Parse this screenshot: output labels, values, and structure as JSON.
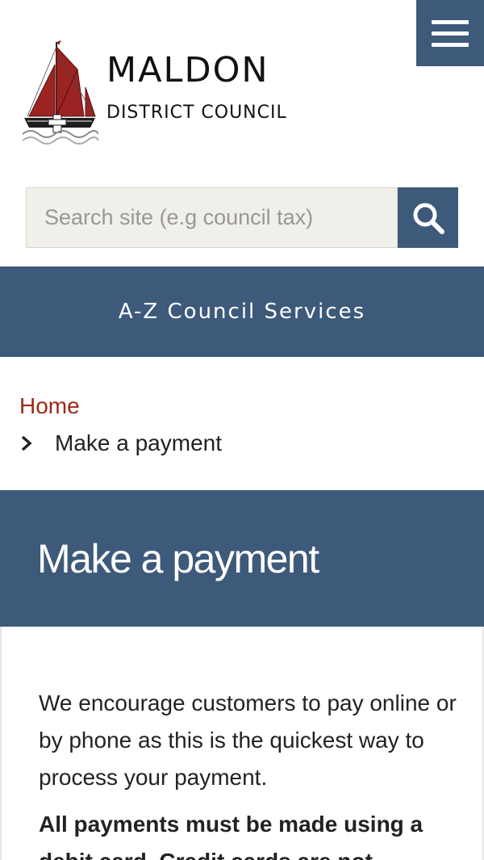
{
  "header": {
    "logo_title": "MALDON",
    "logo_subtitle": "DISTRICT COUNCIL",
    "menu_icon": "hamburger-menu-icon"
  },
  "search": {
    "placeholder": "Search site (e.g council tax)",
    "value": "",
    "icon": "search-icon"
  },
  "az_services": {
    "label": "A-Z Council Services"
  },
  "breadcrumb": {
    "home_label": "Home",
    "separator_icon": "chevron-right-icon",
    "current_label": "Make a payment"
  },
  "page": {
    "title": "Make a payment"
  },
  "content": {
    "paragraph_1": "We encourage customers to pay online or by phone as this is the quickest way to process your payment.",
    "paragraph_2": "All payments must be made using a debit card. Credit cards are not"
  },
  "colors": {
    "brand_blue": "#3e5a7a",
    "link_red": "#9b2a18",
    "search_bg": "#f1efe9",
    "sail_red": "#9b2422"
  }
}
